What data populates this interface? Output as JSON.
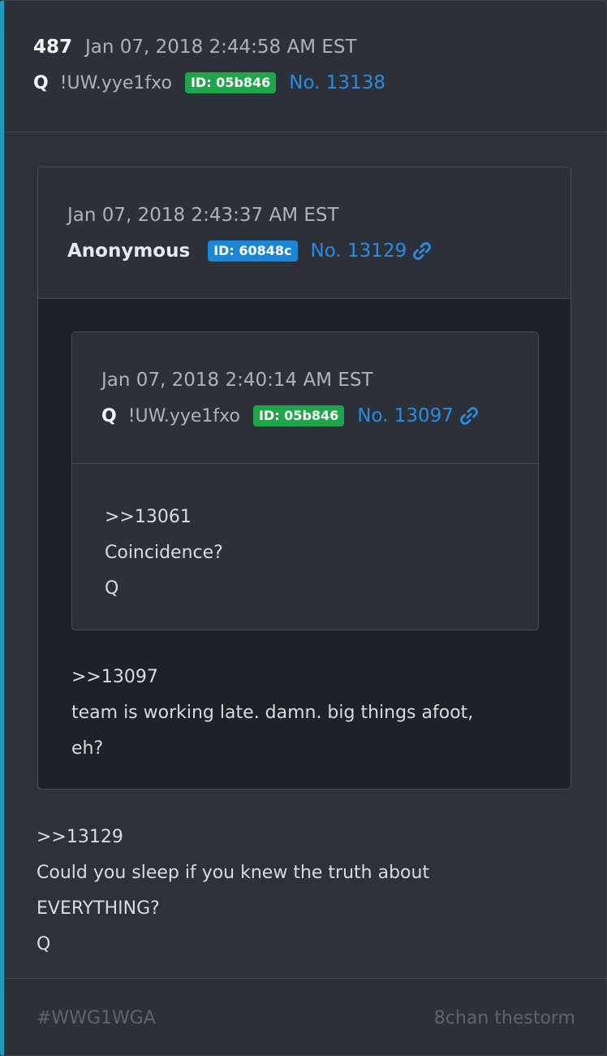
{
  "post": {
    "number": "487",
    "date": "Jan 07, 2018 2:44:58 AM EST",
    "author": "Q",
    "tripcode": "!UW.yye1fxo",
    "id_badge": "ID: 05b846",
    "post_no": "No. 13138",
    "body": [
      ">>13129",
      "Could you sleep if you knew the truth about",
      "EVERYTHING?",
      "Q"
    ]
  },
  "quote": {
    "date": "Jan 07, 2018 2:43:37 AM EST",
    "author": "Anonymous",
    "id_badge": "ID: 60848c",
    "post_no": "No. 13129",
    "body": [
      ">>13097",
      "team is working late. damn. big things afoot,",
      "eh?"
    ]
  },
  "nested_quote": {
    "date": "Jan 07, 2018 2:40:14 AM EST",
    "author": "Q",
    "tripcode": "!UW.yye1fxo",
    "id_badge": "ID: 05b846",
    "post_no": "No. 13097",
    "body": [
      ">>13061",
      "Coincidence?",
      "Q"
    ]
  },
  "footer": {
    "hashtag": "#WWG1WGA",
    "source": "8chan thestorm"
  },
  "colors": {
    "accent_bar": "#1e9bbd",
    "link": "#2a8be0",
    "badge_green": "#1fa64a",
    "badge_blue": "#1c86d6"
  },
  "icons": {
    "link_icon": "chain-link"
  }
}
